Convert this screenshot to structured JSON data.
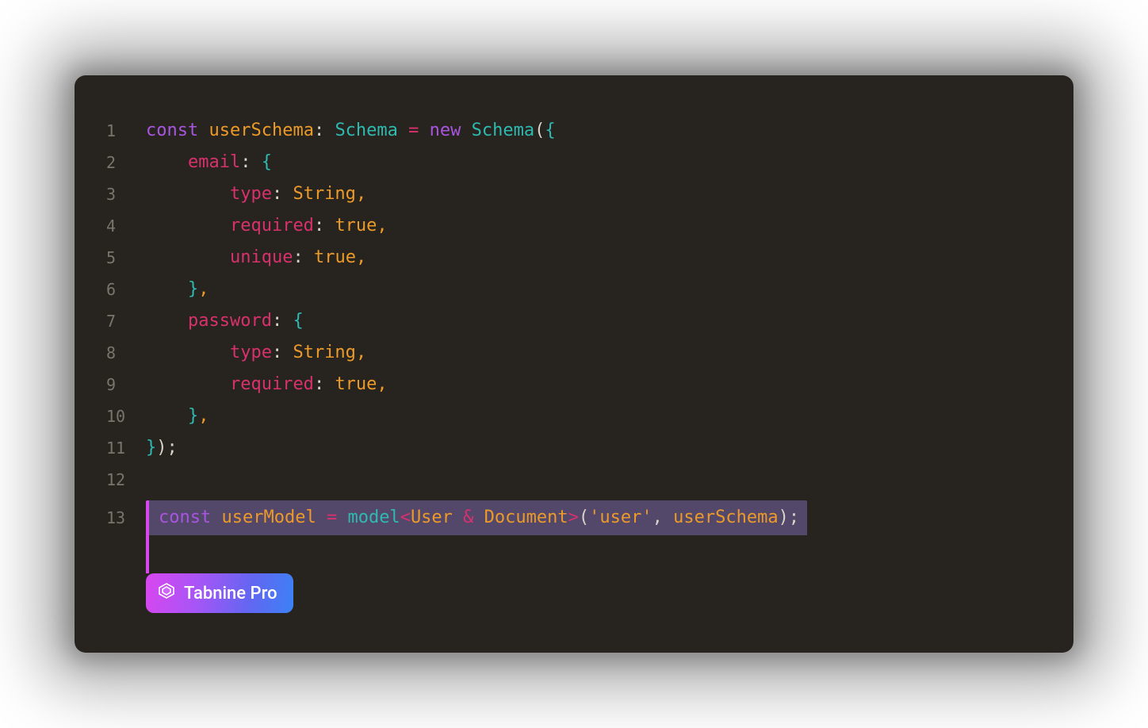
{
  "colors": {
    "keyword": "#a855e0",
    "identifier": "#ec9a29",
    "type": "#2fb9b0",
    "property": "#d8316e",
    "badge_gradient": [
      "#d946ef",
      "#a855f7",
      "#6366f1",
      "#3b82f6"
    ]
  },
  "gutter": {
    "l1": "1",
    "l2": "2",
    "l3": "3",
    "l4": "4",
    "l5": "5",
    "l6": "6",
    "l7": "7",
    "l8": "8",
    "l9": "9",
    "l10": "10",
    "l11": "11",
    "l12": "12",
    "l13": "13"
  },
  "code": {
    "l1": {
      "kw1": "const",
      "sp1": " ",
      "var1": "userSchema",
      "colon": ": ",
      "type1": "Schema",
      "sp2": " ",
      "op": "=",
      "sp3": " ",
      "kw2": "new",
      "sp4": " ",
      "type2": "Schema",
      "paren": "(",
      "brace": "{"
    },
    "l2": {
      "indent": "    ",
      "prop": "email",
      "colon": ": ",
      "brace": "{"
    },
    "l3": {
      "indent": "        ",
      "prop": "type",
      "colon": ": ",
      "val": "String",
      "comma": ","
    },
    "l4": {
      "indent": "        ",
      "prop": "required",
      "colon": ": ",
      "val": "true",
      "comma": ","
    },
    "l5": {
      "indent": "        ",
      "prop": "unique",
      "colon": ": ",
      "val": "true",
      "comma": ","
    },
    "l6": {
      "indent": "    ",
      "brace": "}",
      "comma": ","
    },
    "l7": {
      "indent": "    ",
      "prop": "password",
      "colon": ": ",
      "brace": "{"
    },
    "l8": {
      "indent": "        ",
      "prop": "type",
      "colon": ": ",
      "val": "String",
      "comma": ","
    },
    "l9": {
      "indent": "        ",
      "prop": "required",
      "colon": ": ",
      "val": "true",
      "comma": ","
    },
    "l10": {
      "indent": "    ",
      "brace": "}",
      "comma": ","
    },
    "l11": {
      "brace": "}",
      "paren": ")",
      "semi": ";"
    }
  },
  "suggestion": {
    "kw": "const",
    "sp1": " ",
    "var1": "userModel",
    "sp2": " ",
    "op": "=",
    "sp3": " ",
    "fn": "model",
    "lt": "<",
    "t1": "User",
    "sp4": " ",
    "amp": "&",
    "sp5": " ",
    "t2": "Document",
    "gt": ">",
    "paren1": "(",
    "str": "'user'",
    "comma": ", ",
    "arg": "userSchema",
    "paren2": ")",
    "semi": ";"
  },
  "badge": {
    "label": "Tabnine Pro",
    "icon": "tabnine-logo-icon"
  }
}
